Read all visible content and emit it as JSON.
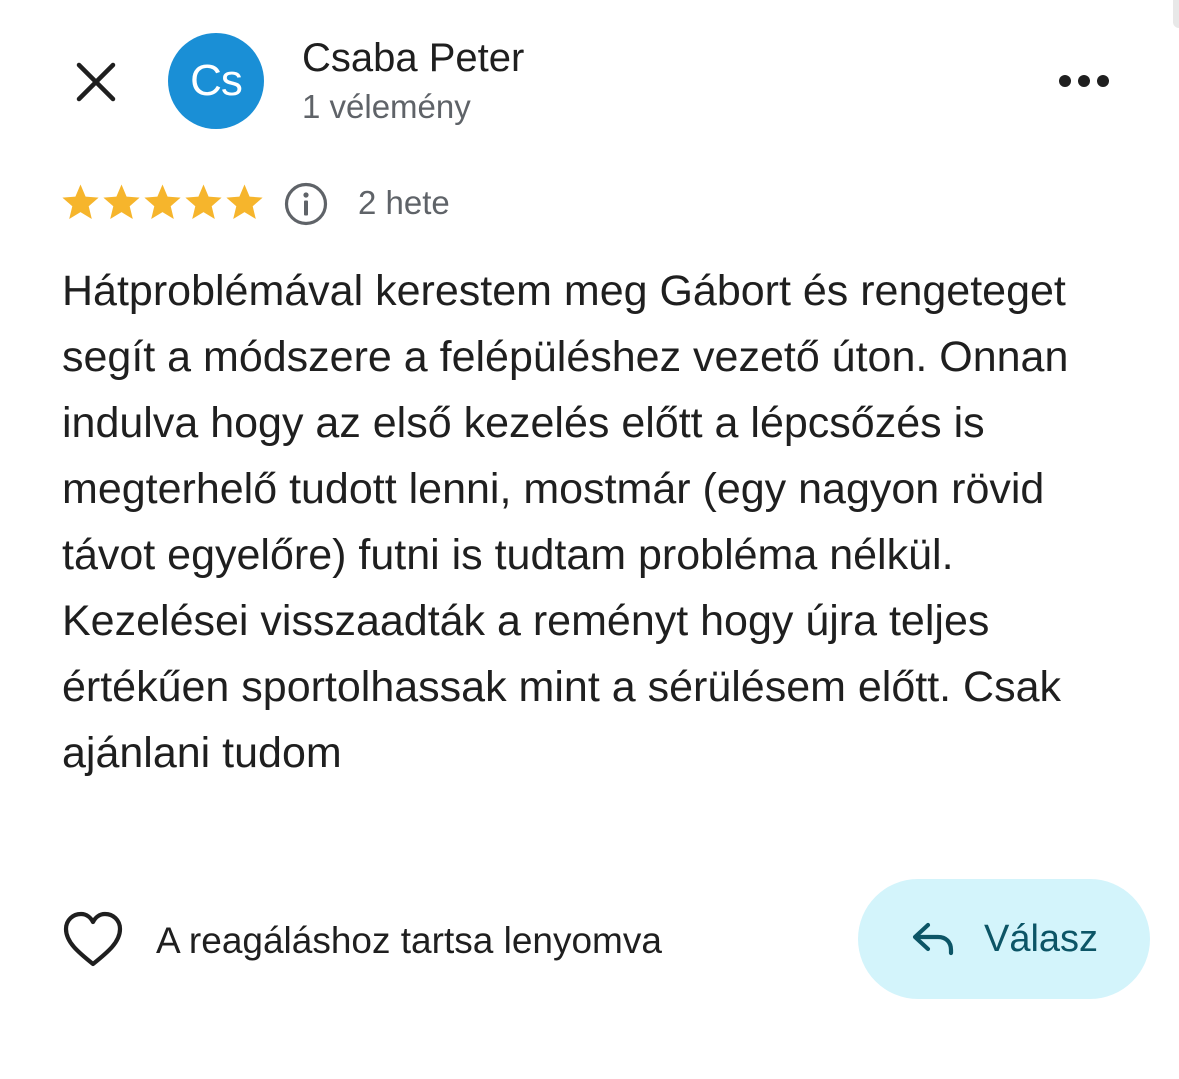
{
  "colors": {
    "avatar_bg": "#1a8fd6",
    "star": "#f6b52c",
    "reply_bg": "#d3f4fb",
    "reply_text": "#0c5566",
    "secondary_text": "#5f6368",
    "primary_text": "#1f1f1f"
  },
  "header": {
    "close_icon": "close-icon",
    "avatar_initials": "Cs",
    "reviewer_name": "Csaba Peter",
    "review_count": "1 vélemény",
    "more_icon": "more-horizontal-icon"
  },
  "rating": {
    "stars": 5,
    "max_stars": 5,
    "info_icon": "info-icon",
    "date": "2 hete"
  },
  "review": {
    "text": "Hátproblémával kerestem meg Gábort és rengeteget segít a módszere a felépüléshez vezető úton. Onnan indulva hogy az első kezelés előtt a lépcsőzés is megterhelő tudott lenni, mostmár (egy nagyon rövid távot egyelőre) futni is tudtam probléma nélkül. Kezelései visszaadták a reményt hogy újra teljes értékűen sportolhassak mint a sérülésem előtt. Csak ajánlani tudom"
  },
  "footer": {
    "heart_icon": "heart-outline-icon",
    "react_label": "A reagáláshoz tartsa lenyomva",
    "reply_icon": "reply-arrow-icon",
    "reply_label": "Válasz"
  }
}
